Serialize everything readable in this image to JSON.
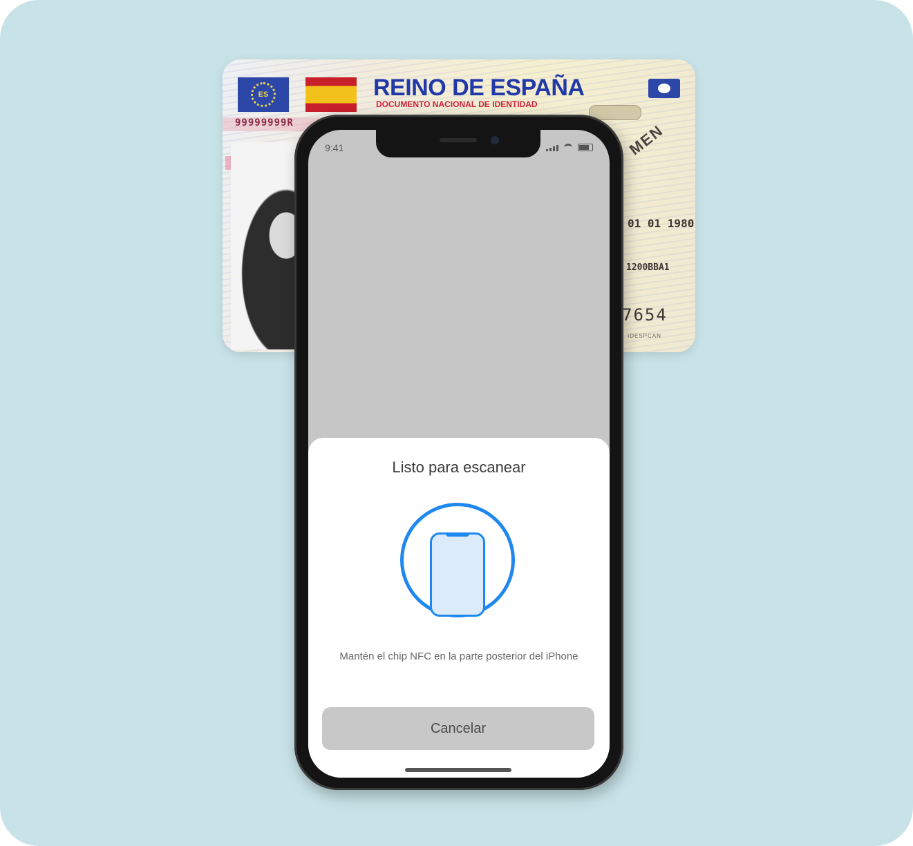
{
  "dni": {
    "title": "REINO DE ESPAÑA",
    "subtitle": "DOCUMENTO NACIONAL DE IDENTIDAD",
    "eu_flag_text": "ES",
    "number": "99999999R",
    "chip_label": "",
    "specimen_text": "MEN",
    "date_text": "01 01 1980",
    "code_text": "1200BBA1",
    "can_text": "7654",
    "small_text": "IDESPCAN"
  },
  "phone": {
    "status_time": "9:41"
  },
  "nfc_sheet": {
    "title": "Listo para escanear",
    "message": "Mantén el chip NFC en la parte posterior del iPhone",
    "cancel_label": "Cancelar"
  },
  "colors": {
    "background": "#c8e3e8",
    "accent_blue": "#1e88ee",
    "card_title_blue": "#2038a8",
    "card_subtitle_red": "#d0203a"
  }
}
